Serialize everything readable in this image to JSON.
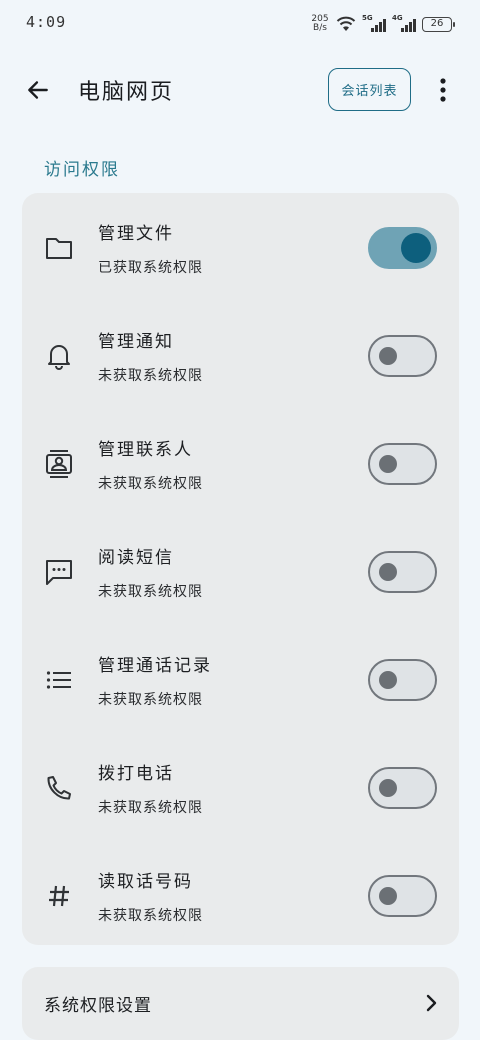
{
  "status_bar": {
    "time": "4:09",
    "net_speed_value": "205",
    "net_speed_unit": "B/s",
    "sim1_tag": "5G",
    "sim2_tag": "4G",
    "battery": "26"
  },
  "app_bar": {
    "title": "电脑网页",
    "session_button": "会话列表"
  },
  "section_title": "访问权限",
  "permissions": [
    {
      "title": "管理文件",
      "status": "已获取系统权限",
      "enabled": true,
      "icon": "folder-icon"
    },
    {
      "title": "管理通知",
      "status": "未获取系统权限",
      "enabled": false,
      "icon": "bell-icon"
    },
    {
      "title": "管理联系人",
      "status": "未获取系统权限",
      "enabled": false,
      "icon": "contact-card-icon"
    },
    {
      "title": "阅读短信",
      "status": "未获取系统权限",
      "enabled": false,
      "icon": "message-icon"
    },
    {
      "title": "管理通话记录",
      "status": "未获取系统权限",
      "enabled": false,
      "icon": "list-icon"
    },
    {
      "title": "拨打电话",
      "status": "未获取系统权限",
      "enabled": false,
      "icon": "phone-icon"
    },
    {
      "title": "读取话号码",
      "status": "未获取系统权限",
      "enabled": false,
      "icon": "hash-icon"
    }
  ],
  "system_settings": {
    "label": "系统权限设置"
  },
  "colors": {
    "accent": "#1f6c86",
    "section_title": "#2b7a8e",
    "toggle_on_track": "#6fa3b5",
    "toggle_on_knob": "#0d5f7d",
    "background": "#f1f6fa",
    "card": "#e9ebec"
  }
}
